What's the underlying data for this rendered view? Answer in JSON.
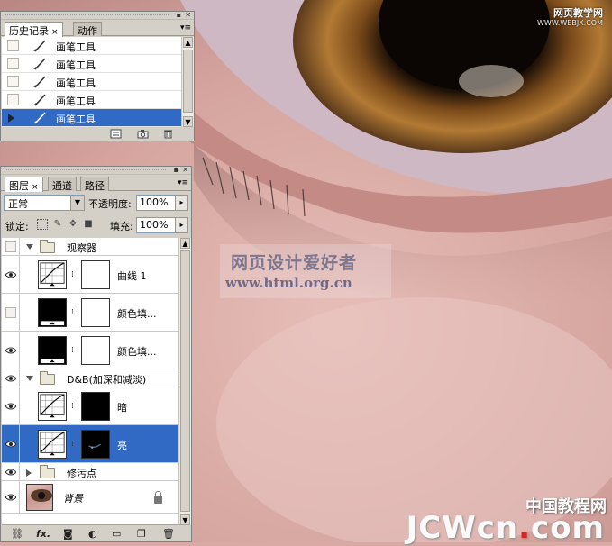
{
  "watermarks": {
    "top_right": "网页教学网",
    "top_right_sub": "WWW.WEBJX.COM",
    "center_line1": "网页设计爱好者",
    "center_line2": "www.html.org.cn",
    "bottom_cn": "中国教程网",
    "bottom_jc_a": "JCW",
    "bottom_jc_b": "cn",
    "bottom_jc_dot": ".",
    "bottom_jc_c": "com"
  },
  "history_panel": {
    "tabs": [
      {
        "label": "历史记录",
        "active": true,
        "close": "×"
      },
      {
        "label": "动作",
        "active": false
      }
    ],
    "menu_glyph": "▾≡",
    "items": [
      {
        "label": "画笔工具",
        "selected": false
      },
      {
        "label": "画笔工具",
        "selected": false
      },
      {
        "label": "画笔工具",
        "selected": false
      },
      {
        "label": "画笔工具",
        "selected": false
      },
      {
        "label": "画笔工具",
        "selected": true
      }
    ],
    "scroll_up": "▲",
    "scroll_down": "▼"
  },
  "layers_panel": {
    "tabs": [
      {
        "label": "图层",
        "active": true,
        "close": "×"
      },
      {
        "label": "通道",
        "active": false
      },
      {
        "label": "路径",
        "active": false
      }
    ],
    "menu_glyph": "▾≡",
    "blend_mode": "正常",
    "opacity_label": "不透明度:",
    "opacity_value": "100%",
    "lock_label": "锁定:",
    "fill_label": "填充:",
    "fill_value": "100%",
    "arrow": "▸",
    "dropdown_arrow": "▼",
    "layers": [
      {
        "kind": "group",
        "name": "观察器",
        "visible": false,
        "open": true
      },
      {
        "kind": "adj",
        "name": "曲线 1",
        "visible": true,
        "mask": "white"
      },
      {
        "kind": "fill",
        "name": "颜色填...",
        "visible": false,
        "mask": "white"
      },
      {
        "kind": "fill",
        "name": "颜色填...",
        "visible": true,
        "mask": "white"
      },
      {
        "kind": "group",
        "name": "D&B(加深和减淡)",
        "visible": true,
        "open": true
      },
      {
        "kind": "adj",
        "name": "暗",
        "visible": true,
        "mask": "black"
      },
      {
        "kind": "adj",
        "name": "亮",
        "visible": true,
        "mask": "black",
        "selected": true
      },
      {
        "kind": "group",
        "name": "修污点",
        "visible": true,
        "open": false
      },
      {
        "kind": "bg",
        "name": "背景",
        "visible": true,
        "locked": true
      }
    ],
    "bottom_buttons": [
      "link-icon",
      "fx-icon",
      "mask-icon",
      "adjustment-icon",
      "folder-icon",
      "new-layer-icon",
      "trash-icon"
    ],
    "fx_label": "fx."
  }
}
